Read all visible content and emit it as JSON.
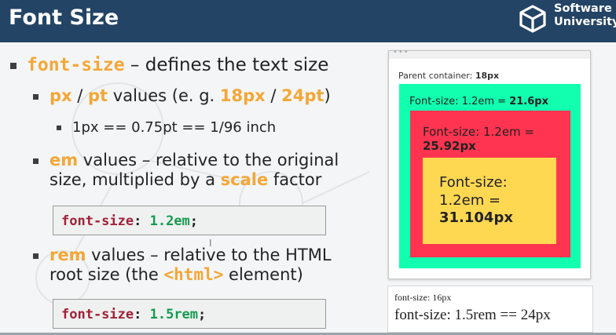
{
  "header": {
    "title": "Font Size",
    "logo_line1": "Software",
    "logo_line2": "University"
  },
  "bullets": {
    "b1_keyword": "font-size",
    "b1_text": " – defines the text size",
    "b2_px": "px",
    "b2_sep": " / ",
    "b2_pt": "pt",
    "b2_text": " values (e. g. ",
    "b2_ex1": "18px",
    "b2_ex2": "24pt",
    "b2_close": ")",
    "b3_text": "1px == 0.75pt == 1/96 inch",
    "b4_em": "em",
    "b4_line1": " values – relative to the original",
    "b4_line2a": "size, multiplied by a ",
    "b4_scale": "scale",
    "b4_line2b": " factor",
    "code1_prop": "font-size",
    "code1_colon": ": ",
    "code1_val": "1.2em",
    "code1_semi": ";",
    "b5_rem": "rem",
    "b5_line1": " values – relative to the HTML",
    "b5_line2a": "root size (the ",
    "b5_tag": "<html>",
    "b5_line2b": " element)",
    "code2_prop": "font-size",
    "code2_colon": ": ",
    "code2_val": "1.5rem",
    "code2_semi": ";"
  },
  "demo": {
    "parent_label": "Parent container: ",
    "parent_value": "18px",
    "green_label": "Font-size: 1.2em = ",
    "green_value": "21.6px",
    "red_label": "Font-size: 1.2em =",
    "red_value": "25.92px",
    "yellow_line1": "Font-size:",
    "yellow_line2": "1.2em =",
    "yellow_value": "31.104px"
  },
  "rem_demo": {
    "line1": "font-size: 16px",
    "line2": "font-size: 1.5rem == 24px"
  },
  "colors": {
    "header_bg": "#234465",
    "accent_orange": "#f3a737",
    "box_green": "#12ffaf",
    "box_red": "#ff3450",
    "box_yellow": "#ffd852",
    "code_prop": "#a0223a",
    "code_value": "#169a52"
  }
}
